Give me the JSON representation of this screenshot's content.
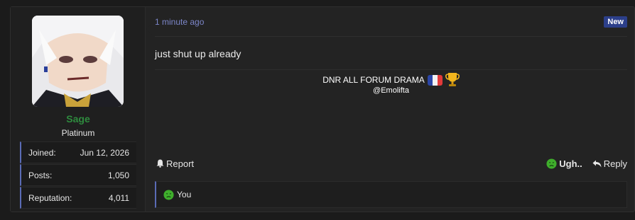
{
  "user": {
    "name": "Sage",
    "title": "Platinum",
    "name_color": "#2e8b3e",
    "stats": [
      {
        "label": "Joined:",
        "value": "Jun 12, 2026"
      },
      {
        "label": "Posts:",
        "value": "1,050"
      },
      {
        "label": "Reputation:",
        "value": "4,011"
      }
    ]
  },
  "post": {
    "timestamp": "1 minute ago",
    "badge": "New",
    "message": "just shut up already",
    "signature": {
      "line1": "DNR ALL FORUM DRAMA",
      "line2": "@Emolifta",
      "icons": [
        "france-flag-icon",
        "trophy-icon"
      ]
    },
    "actions": {
      "report": "Report",
      "react": "Ugh..",
      "reply": "Reply"
    },
    "reactions": {
      "summary": "You",
      "icon": "sick-face-icon"
    }
  },
  "colors": {
    "accent": "#5a6bb5",
    "timestamp": "#7c86c9",
    "badge_bg": "#2c3f8a",
    "reaction_face": "#3fae2c"
  }
}
